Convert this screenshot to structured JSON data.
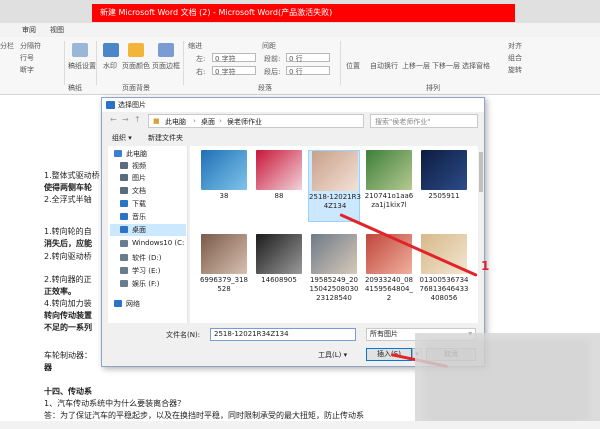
{
  "window": {
    "title": "新建 Microsoft Word 文档 (2) - Microsoft Word(产品激活失败)"
  },
  "menu": [
    "审阅",
    "视图"
  ],
  "ribbon": {
    "labels": [
      "分隔符",
      "行号",
      "断字",
      "稿纸设置",
      "水印",
      "页面颜色",
      "页面边框",
      "缩进",
      "左:",
      "右:",
      "0 字符",
      "0 字符",
      "间距",
      "段前:",
      "段后:",
      "0 行",
      "0 行",
      "位置",
      "自动换行",
      "上移一层",
      "下移一层",
      "选择窗格",
      "对齐",
      "组合",
      "旋转",
      "稿纸",
      "页面背景",
      "段落",
      "排列",
      "分栏"
    ]
  },
  "document": {
    "lines": [
      {
        "text": "1.整体式驱动桥",
        "bold": false
      },
      {
        "text": "使得两侧车轮",
        "bold": true
      },
      {
        "text": "2.全浮式半轴",
        "bold": false
      },
      {
        "text": "1.转向轮的自",
        "bold": false
      },
      {
        "text": "消失后，应能",
        "bold": true
      },
      {
        "text": "2.转向驱动桥",
        "bold": false
      },
      {
        "text": "2.转向器的正",
        "bold": false
      },
      {
        "text": "正效率。",
        "bold": true
      },
      {
        "text": "4.转向加力装",
        "bold": false
      },
      {
        "text": "转向传动装置",
        "bold": true
      },
      {
        "text": "不足的一系列",
        "bold": true
      },
      {
        "text": "车轮制动器：",
        "bold": false
      },
      {
        "text": "器",
        "bold": true
      },
      {
        "text": "十四、传动系",
        "bold": true
      },
      {
        "text": "1、汽车传动系统中为什么要装离合器？",
        "bold": false
      },
      {
        "text": "答：为了保证汽车的平稳起步，以及在换挡时平稳，同时限制承受的最大扭矩，防止传动系",
        "bold": false
      }
    ]
  },
  "dialog": {
    "title": "选择图片",
    "breadcrumb": [
      "此电脑",
      "桌面",
      "侯老师作业"
    ],
    "search_placeholder": "搜索\"侯老师作业\"",
    "toolbar": {
      "organize": "组织 ▾",
      "new_folder": "新建文件夹"
    },
    "tree": [
      {
        "label": "此电脑",
        "icon": "computer-icon",
        "color": "#3c7fd1"
      },
      {
        "label": "视频",
        "icon": "video-icon",
        "color": "#5b6b7e"
      },
      {
        "label": "图片",
        "icon": "pictures-icon",
        "color": "#5b6b7e"
      },
      {
        "label": "文档",
        "icon": "documents-icon",
        "color": "#5b6b7e"
      },
      {
        "label": "下载",
        "icon": "download-icon",
        "color": "#2b73c8"
      },
      {
        "label": "音乐",
        "icon": "music-icon",
        "color": "#2b73c8"
      },
      {
        "label": "桌面",
        "icon": "desktop-icon",
        "color": "#2b73c8",
        "selected": true
      },
      {
        "label": "Windows10 (C:",
        "icon": "drive-icon",
        "color": "#6a7b8e"
      },
      {
        "label": "软件 (D:)",
        "icon": "drive-icon",
        "color": "#6a7b8e"
      },
      {
        "label": "学习 (E:)",
        "icon": "drive-icon",
        "color": "#6a7b8e"
      },
      {
        "label": "娱乐 (F:)",
        "icon": "drive-icon",
        "color": "#6a7b8e"
      },
      {
        "label": "网络",
        "icon": "network-icon",
        "color": "#2b73c8"
      }
    ],
    "files": [
      {
        "name": "38",
        "colors": [
          "#1f6fb6",
          "#7fc4ea"
        ]
      },
      {
        "name": "88",
        "colors": [
          "#c8163a",
          "#f1d3da"
        ]
      },
      {
        "name": "2518-12021R34Z134",
        "colors": [
          "#c9a08a",
          "#f3e1d7"
        ],
        "selected": true
      },
      {
        "name": "210741o1aa6za1j1kix7l",
        "colors": [
          "#3e7f3b",
          "#b5c990"
        ]
      },
      {
        "name": "2505911",
        "colors": [
          "#0d1c3f",
          "#2c4c8a"
        ]
      },
      {
        "name": "6996379_318528",
        "colors": [
          "#7a5a4a",
          "#d8c0b0"
        ]
      },
      {
        "name": "14608905",
        "colors": [
          "#1c1c1c",
          "#9a9a9a"
        ]
      },
      {
        "name": "19585249_201504250803023128540",
        "colors": [
          "#6f7a88",
          "#d6c9b8"
        ]
      },
      {
        "name": "20933240_084159564804_2",
        "colors": [
          "#c0463a",
          "#f0b0a0"
        ]
      },
      {
        "name": "0130053673476813646433408056",
        "colors": [
          "#d8b88a",
          "#f1e6d0"
        ]
      }
    ],
    "filename_label": "文件名(N):",
    "filename_value": "2518-12021R34Z134",
    "filetype_value": "所有图片",
    "tools_label": "工具(L)",
    "insert_label": "插入(S)",
    "cancel_label": "取消"
  },
  "annotation": {
    "number": "1"
  }
}
